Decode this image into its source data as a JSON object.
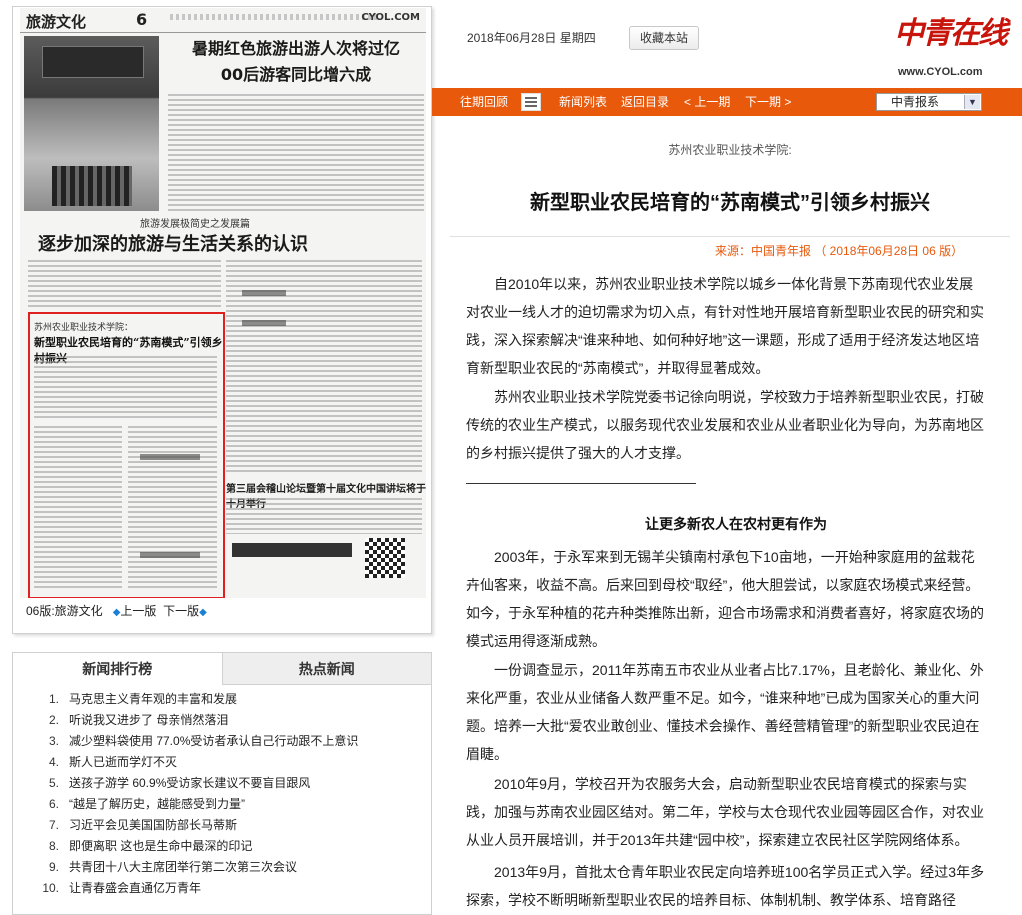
{
  "paper_page": {
    "section": "旅游文化",
    "page_no": "6",
    "site": "CYOL.COM",
    "headline_top": "暑期红色旅游出游人次将过亿\n00后游客同比增六成",
    "series_kicker": "旅游发展极简史之发展篇",
    "headline_mid": "逐步加深的旅游与生活关系的认识",
    "story_kicker": "苏州农业职业技术学院：",
    "story_title": "新型职业农民培育的“苏南模式”引领乡村振兴",
    "headline_bottom": "第三届会稽山论坛暨第十届文化中国讲坛将于十月举行"
  },
  "paper_nav": {
    "current": "06版:旅游文化",
    "prev": "上一版",
    "next": "下一版"
  },
  "ranking": {
    "tab_active": "新闻排行榜",
    "tab_other": "热点新闻",
    "items": [
      {
        "num": "1.",
        "title": "马克思主义青年观的丰富和发展"
      },
      {
        "num": "2.",
        "title": "听说我又进步了 母亲悄然落泪"
      },
      {
        "num": "3.",
        "title": "减少塑料袋使用 77.0%受访者承认自己行动跟不上意识"
      },
      {
        "num": "4.",
        "title": "斯人已逝而学灯不灭"
      },
      {
        "num": "5.",
        "title": "送孩子游学 60.9%受访家长建议不要盲目跟风"
      },
      {
        "num": "6.",
        "title": "“越是了解历史，越能感受到力量”"
      },
      {
        "num": "7.",
        "title": "习近平会见美国国防部长马蒂斯"
      },
      {
        "num": "8.",
        "title": "即便离职 这也是生命中最深的印记"
      },
      {
        "num": "9.",
        "title": "共青团十八大主席团举行第二次第三次会议"
      },
      {
        "num": "10.",
        "title": "让青春盛会直通亿万青年"
      }
    ]
  },
  "header": {
    "date": "2018年06月28日  星期四",
    "bookmark": "收藏本站",
    "logo_text": "中青在线",
    "logo_url": "www.CYOL.com"
  },
  "navbar": {
    "past": "往期回顾",
    "news_list": "新闻列表",
    "back_toc": "返回目录",
    "prev_issue": "< 上一期",
    "next_issue": "下一期 >",
    "paper_select": "中青报系"
  },
  "article": {
    "kicker": "苏州农业职业技术学院:",
    "title": "新型职业农民培育的“苏南模式”引领乡村振兴",
    "meta": "来源：中国青年报    （ 2018年06月28日   06 版）",
    "p1": "自2010年以来，苏州农业职业技术学院以城乡一体化背景下苏南现代农业发展对农业一线人才的迫切需求为切入点，有针对性地开展培育新型职业农民的研究和实践，深入探索解决“谁来种地、如何种好地”这一课题，形成了适用于经济发达地区培育新型职业农民的“苏南模式”，并取得显著成效。",
    "p2": "苏州农业职业技术学院党委书记徐向明说，学校致力于培养新型职业农民，打破传统的农业生产模式，以服务现代农业发展和农业从业者职业化为导向，为苏南地区的乡村振兴提供了强大的人才支撑。",
    "subtitle": "让更多新农人在农村更有作为",
    "p3": "2003年，于永军来到无锡羊尖镇南村承包下10亩地，一开始种家庭用的盆栽花卉仙客来，收益不高。后来回到母校“取经”，他大胆尝试，以家庭农场模式来经营。如今，于永军种植的花卉种类推陈出新，迎合市场需求和消费者喜好，将家庭农场的模式运用得逐渐成熟。",
    "p4": "一份调查显示，2011年苏南五市农业从业者占比7.17%，且老龄化、兼业化、外来化严重，农业从业储备人数严重不足。如今，“谁来种地”已成为国家关心的重大问题。培养一大批“爱农业敢创业、懂技术会操作、善经营精管理”的新型职业农民迫在眉睫。",
    "p5": "2010年9月，学校召开为农服务大会，启动新型职业农民培育模式的探索与实践，加强与苏南农业园区结对。第二年，学校与太仓现代农业园等园区合作，对农业从业人员开展培训，并于2013年共建“园中校”，探索建立农民社区学院网络体系。",
    "p6": "2013年9月，首批太仓青年职业农民定向培养班100名学员正式入学。经过3年多探索，学校不断明晰新型职业农民的培养目标、体制机制、教学体系、培育路径"
  },
  "colors": {
    "nav_orange": "#e8590c",
    "highlight_red": "#e02020",
    "logo_red": "#c8140a",
    "nav_blue_arrow": "#1a7fd6"
  }
}
